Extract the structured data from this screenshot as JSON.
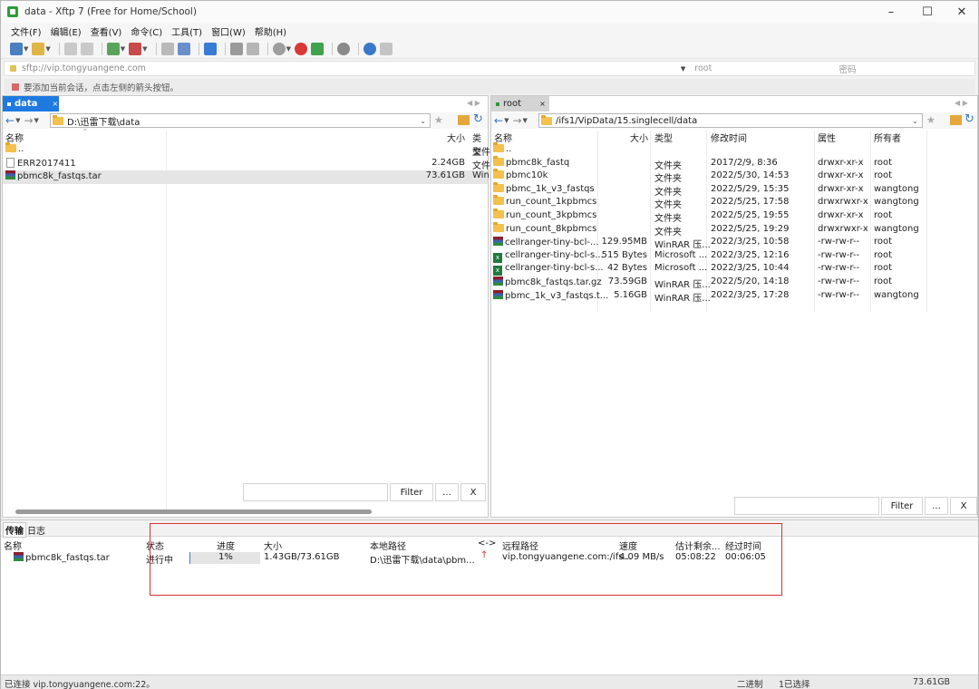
{
  "window": {
    "title": "data - Xftp 7 (Free for Home/School)"
  },
  "menu": [
    "文件(F)",
    "编辑(E)",
    "查看(V)",
    "命令(C)",
    "工具(T)",
    "窗口(W)",
    "帮助(H)"
  ],
  "address": {
    "url": "sftp://vip.tongyuangene.com",
    "user_placeholder": "root",
    "password_placeholder": "密码"
  },
  "session_hint": "要添加当前会话，点击左侧的箭头按钮。",
  "left": {
    "tab": "data",
    "path": "D:\\迅雷下载\\data",
    "columns": {
      "name": "名称",
      "size": "大小",
      "type": "类型"
    },
    "rows": [
      {
        "name": "..",
        "size": "",
        "type": "文件"
      },
      {
        "name": "ERR2017411",
        "size": "2.24GB",
        "type": "文件"
      },
      {
        "name": "pbmc8k_fastqs.tar",
        "size": "73.61GB",
        "type": "Win"
      }
    ],
    "filter_label": "Filter",
    "ellipsis": "...",
    "close": "X"
  },
  "right": {
    "tab": "root",
    "path": "/ifs1/VipData/15.singlecell/data",
    "columns": {
      "name": "名称",
      "size": "大小",
      "type": "类型",
      "modified": "修改时间",
      "attr": "属性",
      "owner": "所有者"
    },
    "rows": [
      {
        "name": "..",
        "size": "",
        "type": "",
        "modified": "",
        "attr": "",
        "owner": "",
        "icon": "folder"
      },
      {
        "name": "pbmc8k_fastq",
        "size": "",
        "type": "文件夹",
        "modified": "2017/2/9, 8:36",
        "attr": "drwxr-xr-x",
        "owner": "root",
        "icon": "folder"
      },
      {
        "name": "pbmc10k",
        "size": "",
        "type": "文件夹",
        "modified": "2022/5/30, 14:53",
        "attr": "drwxr-xr-x",
        "owner": "root",
        "icon": "folder"
      },
      {
        "name": "pbmc_1k_v3_fastqs",
        "size": "",
        "type": "文件夹",
        "modified": "2022/5/29, 15:35",
        "attr": "drwxr-xr-x",
        "owner": "wangtong",
        "icon": "folder"
      },
      {
        "name": "run_count_1kpbmcs",
        "size": "",
        "type": "文件夹",
        "modified": "2022/5/25, 17:58",
        "attr": "drwxrwxr-x",
        "owner": "wangtong",
        "icon": "folder"
      },
      {
        "name": "run_count_3kpbmcs",
        "size": "",
        "type": "文件夹",
        "modified": "2022/5/25, 19:55",
        "attr": "drwxr-xr-x",
        "owner": "root",
        "icon": "folder"
      },
      {
        "name": "run_count_8kpbmcs",
        "size": "",
        "type": "文件夹",
        "modified": "2022/5/25, 19:29",
        "attr": "drwxrwxr-x",
        "owner": "wangtong",
        "icon": "folder"
      },
      {
        "name": "cellranger-tiny-bcl-...",
        "size": "129.95MB",
        "type": "WinRAR 压...",
        "modified": "2022/3/25, 10:58",
        "attr": "-rw-rw-r--",
        "owner": "root",
        "icon": "rar"
      },
      {
        "name": "cellranger-tiny-bcl-s...",
        "size": "515 Bytes",
        "type": "Microsoft ...",
        "modified": "2022/3/25, 12:16",
        "attr": "-rw-rw-r--",
        "owner": "root",
        "icon": "xls"
      },
      {
        "name": "cellranger-tiny-bcl-s...",
        "size": "42 Bytes",
        "type": "Microsoft ...",
        "modified": "2022/3/25, 10:44",
        "attr": "-rw-rw-r--",
        "owner": "root",
        "icon": "xls"
      },
      {
        "name": "pbmc8k_fastqs.tar.gz",
        "size": "73.59GB",
        "type": "WinRAR 压...",
        "modified": "2022/5/20, 14:18",
        "attr": "-rw-rw-r--",
        "owner": "root",
        "icon": "rar"
      },
      {
        "name": "pbmc_1k_v3_fastqs.t...",
        "size": "5.16GB",
        "type": "WinRAR 压...",
        "modified": "2022/3/25, 17:28",
        "attr": "-rw-rw-r--",
        "owner": "wangtong",
        "icon": "rar"
      }
    ],
    "filter_label": "Filter",
    "ellipsis": "...",
    "close": "X"
  },
  "transfer": {
    "tabs": [
      "传输",
      "日志"
    ],
    "columns": {
      "name": "名称",
      "status": "状态",
      "progress": "进度",
      "size": "大小",
      "local": "本地路径",
      "dir": "<->",
      "remote": "远程路径",
      "speed": "速度",
      "eta": "估计剩余...",
      "elapsed": "经过时间"
    },
    "item": {
      "name": "pbmc8k_fastqs.tar",
      "status": "进行中",
      "progress": "1%",
      "progress_value": 0.01,
      "size": "1.43GB/73.61GB",
      "local": "D:\\迅雷下载\\data\\pbm...",
      "remote": "vip.tongyuangene.com:/ifs...",
      "speed": "4.09 MB/s",
      "eta": "05:08:22",
      "elapsed": "00:06:05"
    },
    "highlight_color": "#d93030"
  },
  "status": {
    "connection": "已连接 vip.tongyuangene.com:22。",
    "mode": "二进制",
    "selection": "1已选择",
    "size": "73.61GB"
  }
}
